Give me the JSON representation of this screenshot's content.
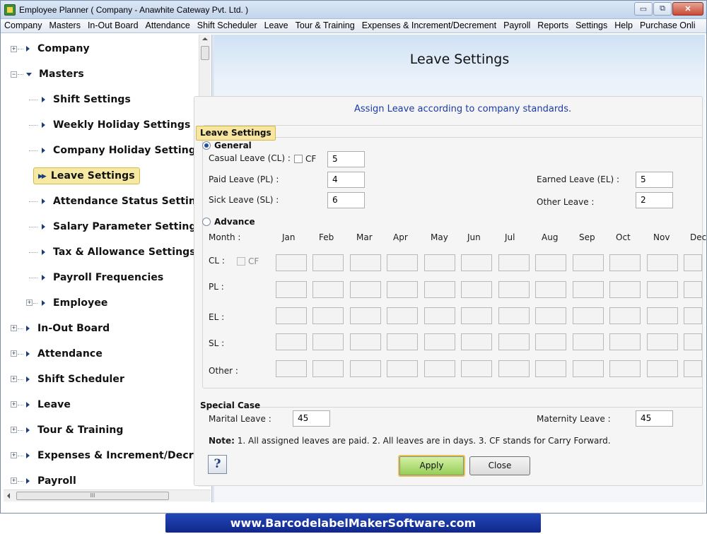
{
  "window": {
    "title": "Employee Planner ( Company - Anawhite Cateway Pvt. Ltd. )",
    "controls": {
      "minimize": "▭",
      "restore": "⧉",
      "close": "✕"
    }
  },
  "menu": [
    "Company",
    "Masters",
    "In-Out Board",
    "Attendance",
    "Shift Scheduler",
    "Leave",
    "Tour & Training",
    "Expenses & Increment/Decrement",
    "Payroll",
    "Reports",
    "Settings",
    "Help",
    "Purchase Onli"
  ],
  "tree": {
    "items": [
      {
        "label": "Company"
      },
      {
        "label": "Masters"
      },
      {
        "label": "Shift Settings"
      },
      {
        "label": "Weekly Holiday Settings"
      },
      {
        "label": "Company Holiday Settings"
      },
      {
        "label": "Leave Settings"
      },
      {
        "label": "Attendance Status Settings"
      },
      {
        "label": "Salary Parameter Settings"
      },
      {
        "label": "Tax & Allowance Settings"
      },
      {
        "label": "Payroll Frequencies"
      },
      {
        "label": "Employee"
      },
      {
        "label": "In-Out Board"
      },
      {
        "label": "Attendance"
      },
      {
        "label": "Shift Scheduler"
      },
      {
        "label": "Leave"
      },
      {
        "label": "Tour & Training"
      },
      {
        "label": "Expenses & Increment/Decrement"
      },
      {
        "label": "Payroll"
      }
    ],
    "hscroll_grip": "III"
  },
  "page": {
    "title": "Leave Settings",
    "subtitle": "Assign Leave according to company standards.",
    "group_title": "Leave Settings"
  },
  "general": {
    "label": "General",
    "selected": true,
    "casual_label": "Casual Leave (CL) :",
    "cf_label": "CF",
    "casual_value": "5",
    "paid_label": "Paid Leave (PL) :",
    "paid_value": "4",
    "sick_label": "Sick Leave (SL) :",
    "sick_value": "6",
    "earned_label": "Earned Leave (EL) :",
    "earned_value": "5",
    "other_label": "Other Leave :",
    "other_value": "2"
  },
  "advance": {
    "label": "Advance",
    "month_label": "Month :",
    "months": [
      "Jan",
      "Feb",
      "Mar",
      "Apr",
      "May",
      "Jun",
      "Jul",
      "Aug",
      "Sep",
      "Oct",
      "Nov",
      "Dec"
    ],
    "rows": [
      {
        "label": "CL :",
        "cf": "CF"
      },
      {
        "label": "PL :"
      },
      {
        "label": "EL :"
      },
      {
        "label": "SL :"
      },
      {
        "label": "Other :"
      }
    ]
  },
  "special": {
    "title": "Special Case",
    "marital_label": "Marital Leave :",
    "marital_value": "45",
    "maternity_label": "Maternity Leave :",
    "maternity_value": "45"
  },
  "note": {
    "prefix": "Note:",
    "text": "1. All assigned leaves are paid. 2. All leaves are in days. 3. CF stands for Carry Forward."
  },
  "buttons": {
    "help": "?",
    "apply": "Apply",
    "close": "Close"
  },
  "footer": "www.BarcodelabelMakerSoftware.com"
}
